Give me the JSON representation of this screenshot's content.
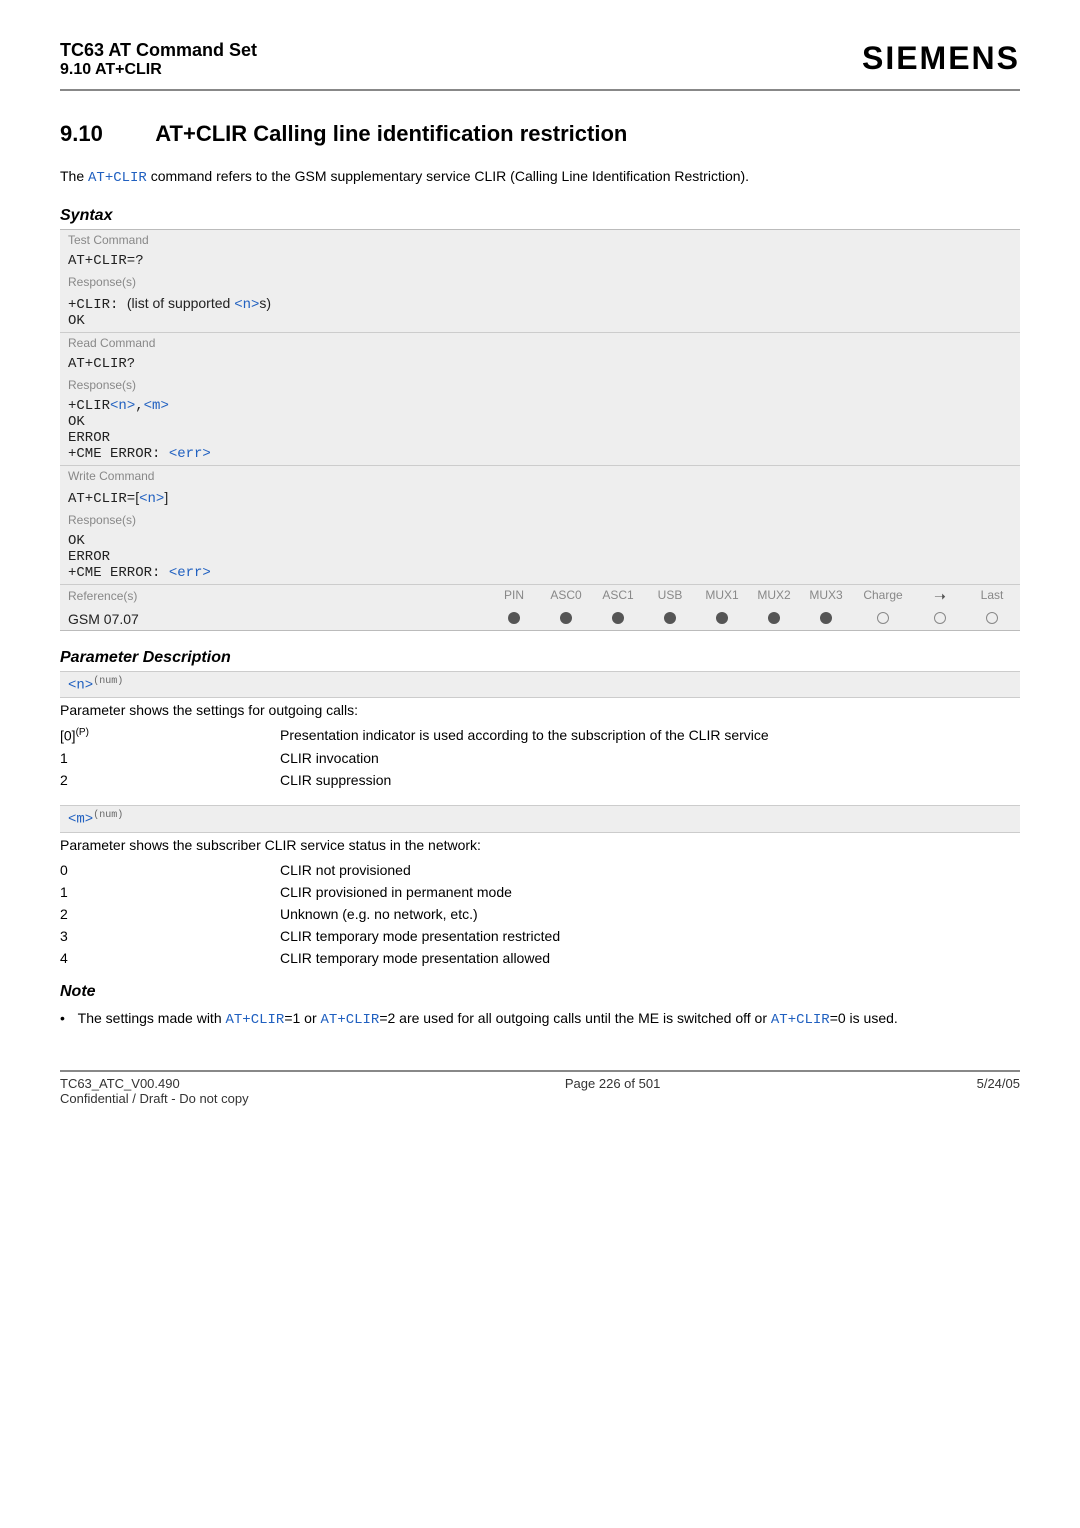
{
  "header": {
    "title": "TC63 AT Command Set",
    "subtitle": "9.10 AT+CLIR",
    "brand": "SIEMENS"
  },
  "section": {
    "number": "9.10",
    "title": "AT+CLIR   Calling line identification restriction"
  },
  "intro": {
    "pre": "The ",
    "link": "AT+CLIR",
    "post": " command refers to the GSM supplementary service CLIR (Calling Line Identification Restriction)."
  },
  "syntax_heading": "Syntax",
  "test": {
    "label": "Test Command",
    "cmd": "AT+CLIR=?",
    "resp_label": "Response(s)",
    "resp_line1a": "+CLIR: ",
    "resp_line1b": "(list of supported ",
    "resp_line1c": "<n>",
    "resp_line1d": "s)",
    "resp_line2": "OK"
  },
  "read": {
    "label": "Read Command",
    "cmd": "AT+CLIR?",
    "resp_label": "Response(s)",
    "r1a": "+CLIR",
    "r1b": "<n>",
    "r1c": ",",
    "r1d": "<m>",
    "r2": "OK",
    "r3": "ERROR",
    "r4a": "+CME ERROR: ",
    "r4b": "<err>"
  },
  "write": {
    "label": "Write Command",
    "cmd_a": "AT+CLIR=",
    "cmd_b": "[",
    "cmd_c": "<n>",
    "cmd_d": "]",
    "resp_label": "Response(s)",
    "r1": "OK",
    "r2": "ERROR",
    "r3a": "+CME ERROR: ",
    "r3b": "<err>"
  },
  "ref": {
    "label": "Reference(s)",
    "cols": [
      "PIN",
      "ASC0",
      "ASC1",
      "USB",
      "MUX1",
      "MUX2",
      "MUX3",
      "Charge",
      "➝",
      "Last"
    ],
    "value": "GSM 07.07",
    "dots": [
      "f",
      "f",
      "f",
      "f",
      "f",
      "f",
      "f",
      "o",
      "o",
      "o"
    ]
  },
  "pd_heading": "Parameter Description",
  "param_n": {
    "tag_a": "<n>",
    "tag_b": "(num)",
    "desc": "Parameter shows the settings for outgoing calls:",
    "rows": [
      {
        "k": "[0]",
        "ksup": "(P)",
        "v": "Presentation indicator is used according to the subscription of the CLIR service"
      },
      {
        "k": "1",
        "v": "CLIR invocation"
      },
      {
        "k": "2",
        "v": "CLIR suppression"
      }
    ]
  },
  "param_m": {
    "tag_a": "<m>",
    "tag_b": "(num)",
    "desc": "Parameter shows the subscriber CLIR service status in the network:",
    "rows": [
      {
        "k": "0",
        "v": "CLIR not provisioned"
      },
      {
        "k": "1",
        "v": "CLIR provisioned in permanent mode"
      },
      {
        "k": "2",
        "v": "Unknown (e.g. no network, etc.)"
      },
      {
        "k": "3",
        "v": "CLIR temporary mode presentation restricted"
      },
      {
        "k": "4",
        "v": "CLIR temporary mode presentation allowed"
      }
    ]
  },
  "note_heading": "Note",
  "note": {
    "bullet": "•",
    "t1": "The settings made with ",
    "l1": "AT+CLIR",
    "t2": "=1 or ",
    "l2": "AT+CLIR",
    "t3": "=2 are used for all outgoing calls until the ME is switched off or ",
    "l3": "AT+CLIR",
    "t4": "=0 is used."
  },
  "footer": {
    "left1": "TC63_ATC_V00.490",
    "left2": "Confidential / Draft - Do not copy",
    "center": "Page 226 of 501",
    "right": "5/24/05"
  }
}
